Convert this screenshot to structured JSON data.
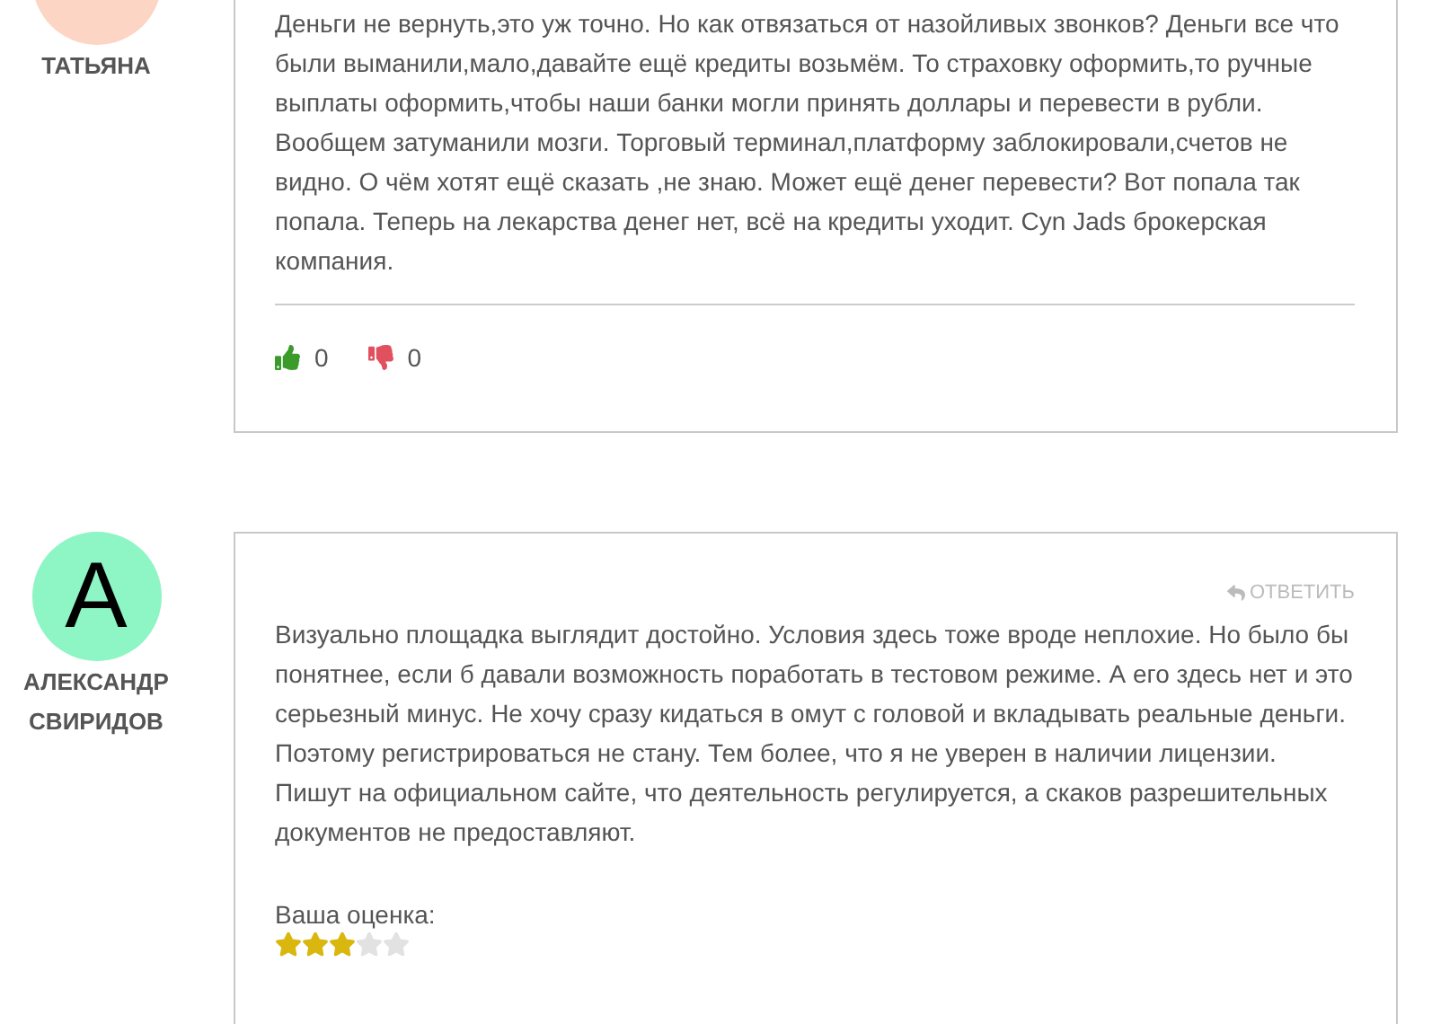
{
  "reviews": [
    {
      "author": {
        "name": "ТАТЬЯНА",
        "color": "#fcd5c5"
      },
      "text": "Деньги не вернуть,это уж точно. Но как отвязаться от назойливых звонков? Деньги все что были выманили,мало,давайте ещё кредиты возьмём. То страховку оформить,то ручные выплаты оформить,чтобы наши банки могли принять доллары и перевести в рубли. Вообщем затуманили мозги. Торговый терминал,платформу заблокировали,счетов не видно. О чём хотят ещё сказать ,не знаю. Может ещё денег перевести? Вот попала так попала. Теперь на лекарства денег нет, всё на кредиты уходит. Cyn Jads брокерская компания.",
      "votes": {
        "up": "0",
        "down": "0"
      }
    },
    {
      "author": {
        "name": "АЛЕКСАНДР СВИРИДОВ",
        "letter": "А",
        "color": "#8ef5c4"
      },
      "reply_label": "ОТВЕТИТЬ",
      "text": "Визуально площадка выглядит достойно. Условия здесь тоже вроде неплохие. Но было бы понятнее, если б давали возможность поработать в тестовом режиме. А его здесь нет и это серьезный минус. Не хочу сразу кидаться в омут с головой и вкладывать реальные деньги. Поэтому регистрироваться не стану. Тем более, что я не уверен в наличии лицензии. Пишут на официальном сайте, что деятельность регулируется, а скаков разрешительных документов не предоставляют.",
      "rating": {
        "label": "Ваша оценка:",
        "stars": 3
      }
    }
  ]
}
